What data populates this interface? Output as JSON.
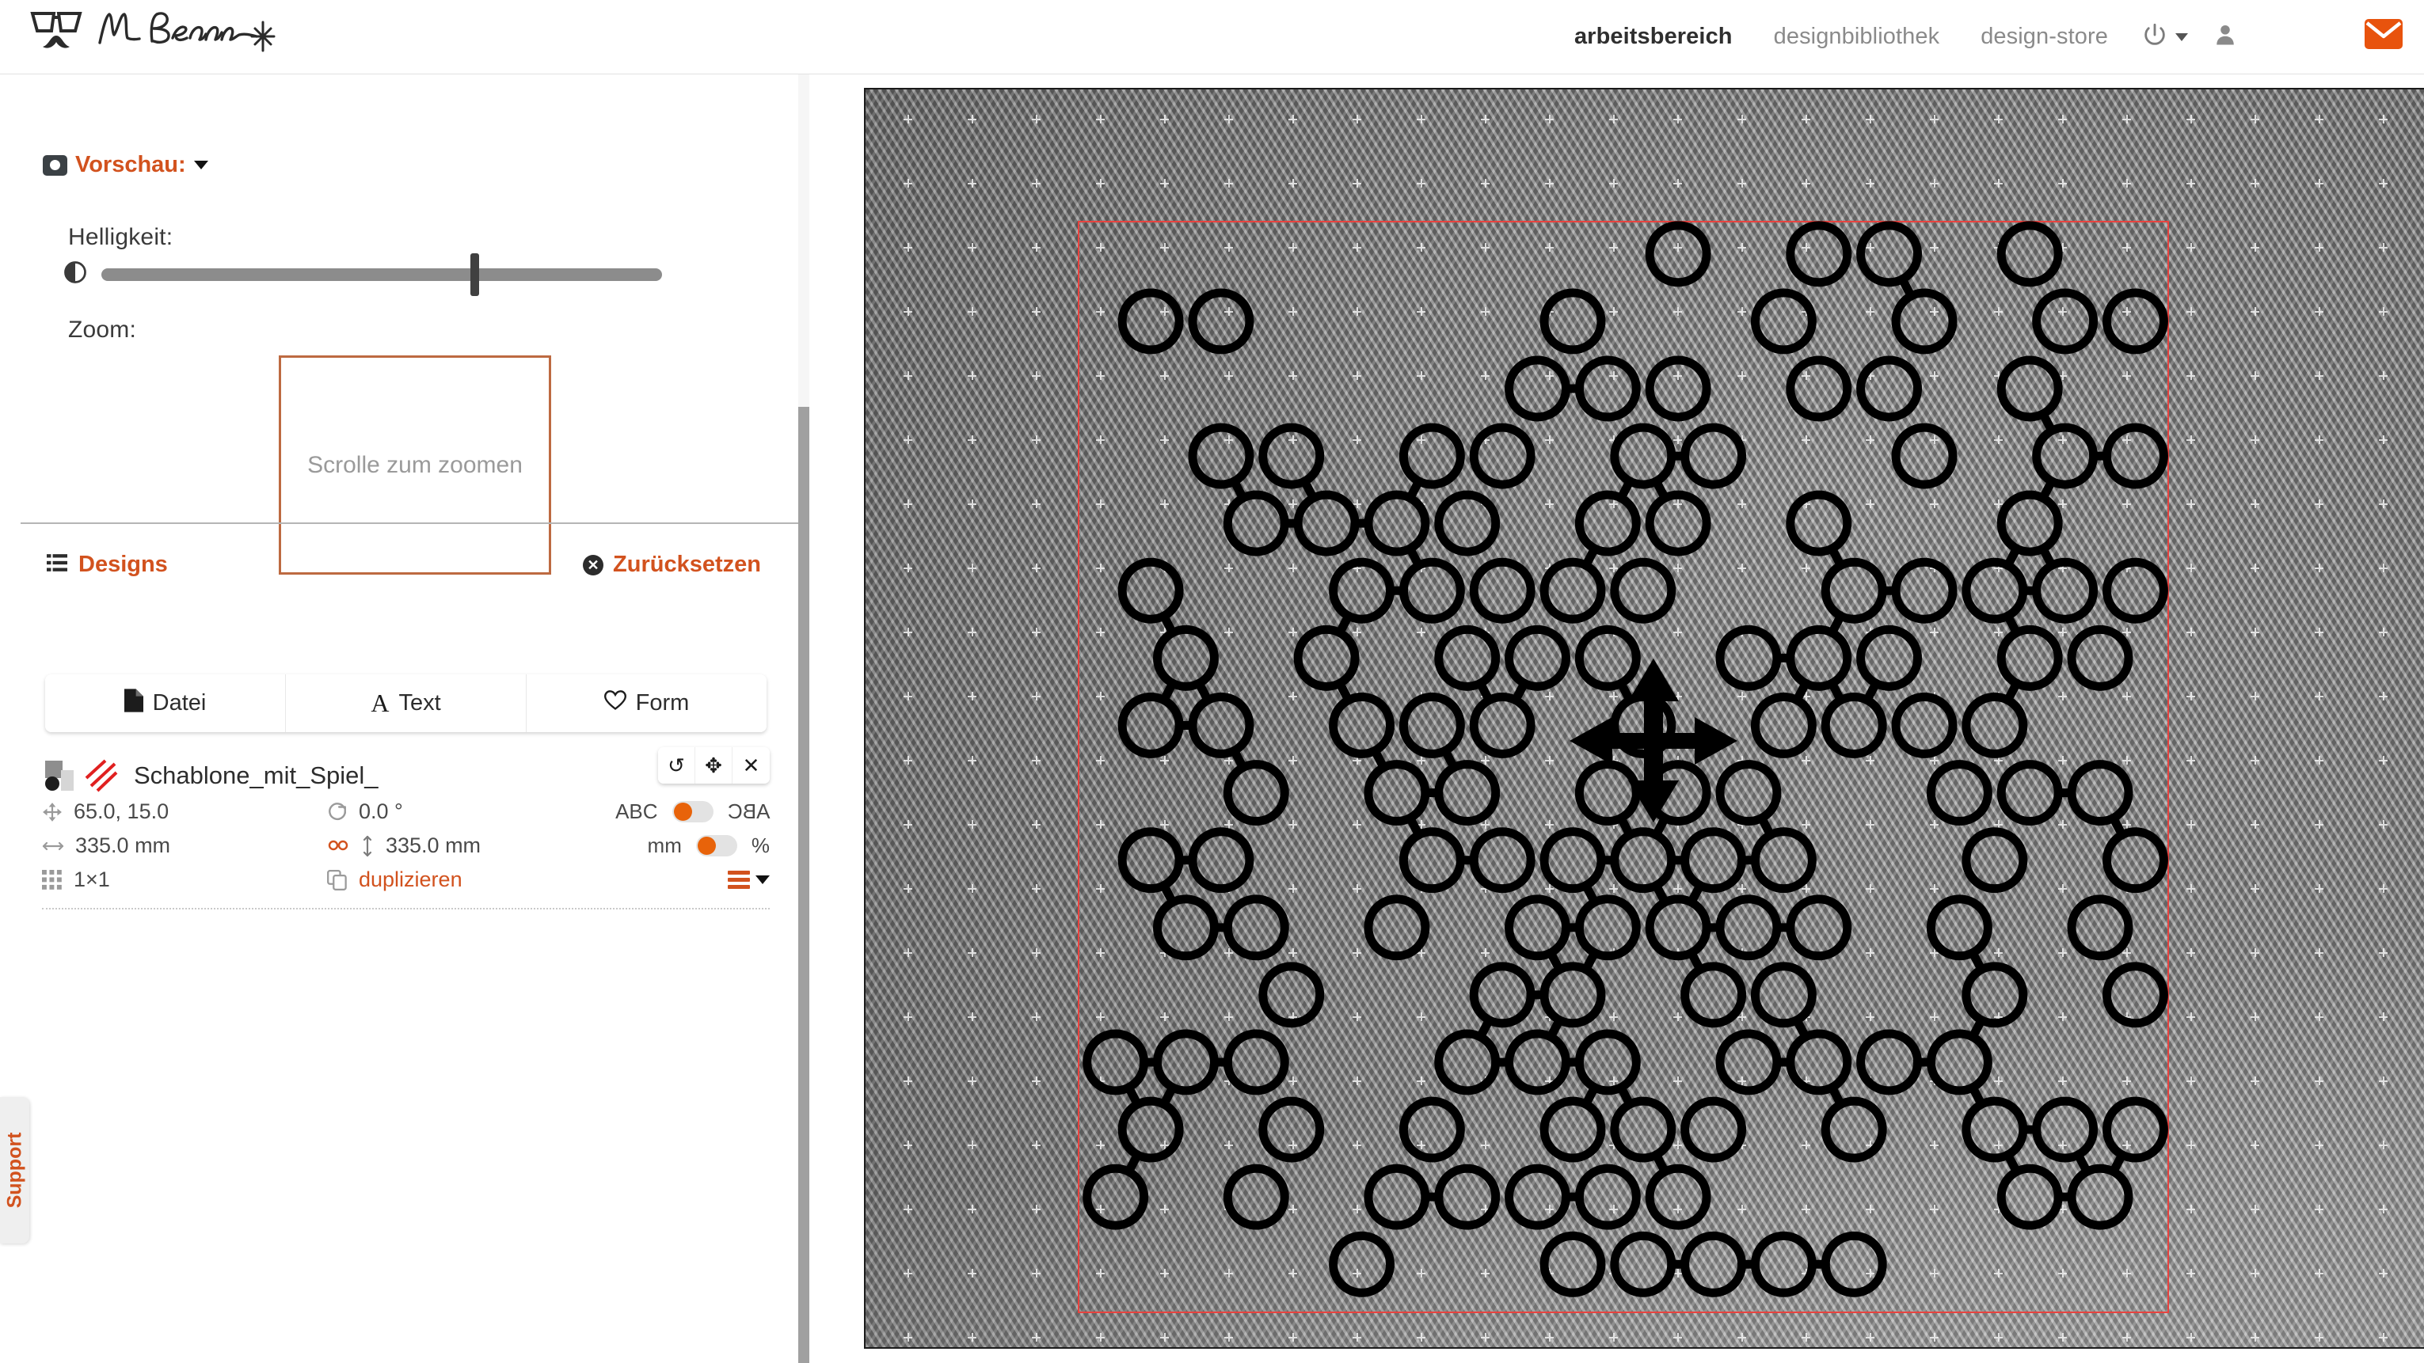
{
  "header": {
    "brand_name": "Mr Beam",
    "brand_icon": "glasses-mustache-logo",
    "nav": [
      {
        "label": "arbeitsbereich",
        "active": true
      },
      {
        "label": "designbibliothek",
        "active": false
      },
      {
        "label": "design-store",
        "active": false
      }
    ],
    "power_icon": "power-icon",
    "user_icon": "user-icon",
    "mail_icon": "envelope-icon",
    "accent_color": "#e8630a"
  },
  "left_panel": {
    "preview": {
      "title": "Vorschau:",
      "camera_icon": "camera-icon",
      "caret_icon": "chevron-down-icon",
      "brightness_label": "Helligkeit:",
      "brightness_icon": "contrast-icon",
      "brightness_value": 66,
      "zoom_label": "Zoom:",
      "zoom_hint": "Scrolle zum zoomen"
    },
    "designs": {
      "title": "Designs",
      "list_icon": "list-icon",
      "reset_label": "Zurücksetzen",
      "reset_icon": "close-circle-icon",
      "add_buttons": [
        {
          "label": "Datei",
          "icon": "file-icon"
        },
        {
          "label": "Text",
          "icon": "text-icon"
        },
        {
          "label": "Form",
          "icon": "heart-icon"
        }
      ],
      "item": {
        "name": "Schablone_mit_Spiel_",
        "thumb_image_icon": "image-thumbnail",
        "thumb_vector_icon": "vector-lines-thumbnail",
        "actions": [
          {
            "name": "reset-transform",
            "glyph": "↺"
          },
          {
            "name": "move",
            "glyph": "✥"
          },
          {
            "name": "remove",
            "glyph": "✕"
          }
        ],
        "position_icon": "move-icon",
        "position": "65.0, 15.0",
        "rotation_icon": "rotate-icon",
        "rotation": "0.0 °",
        "width_icon": "width-icon",
        "width": "335.0 mm",
        "lock_ratio_icon": "link-icon",
        "height_icon": "height-icon",
        "height": "335.0 mm",
        "grid_icon": "grid-icon",
        "grid": "1×1",
        "duplicate_icon": "copy-icon",
        "duplicate_label": "duplizieren",
        "menu_icon": "hamburger-menu-icon",
        "toggle_mirror": {
          "left_label": "ABC",
          "right_label": "ABC",
          "state": "off"
        },
        "toggle_units": {
          "left_label": "mm",
          "right_label": "%",
          "state": "off"
        }
      }
    },
    "support_tab": "Support"
  },
  "working_area": {
    "camera_surface": "gray-textured-material",
    "selection_color": "#e8433f",
    "move_handle_icon": "four-way-move-handle",
    "design_stroke_color": "#000000"
  }
}
